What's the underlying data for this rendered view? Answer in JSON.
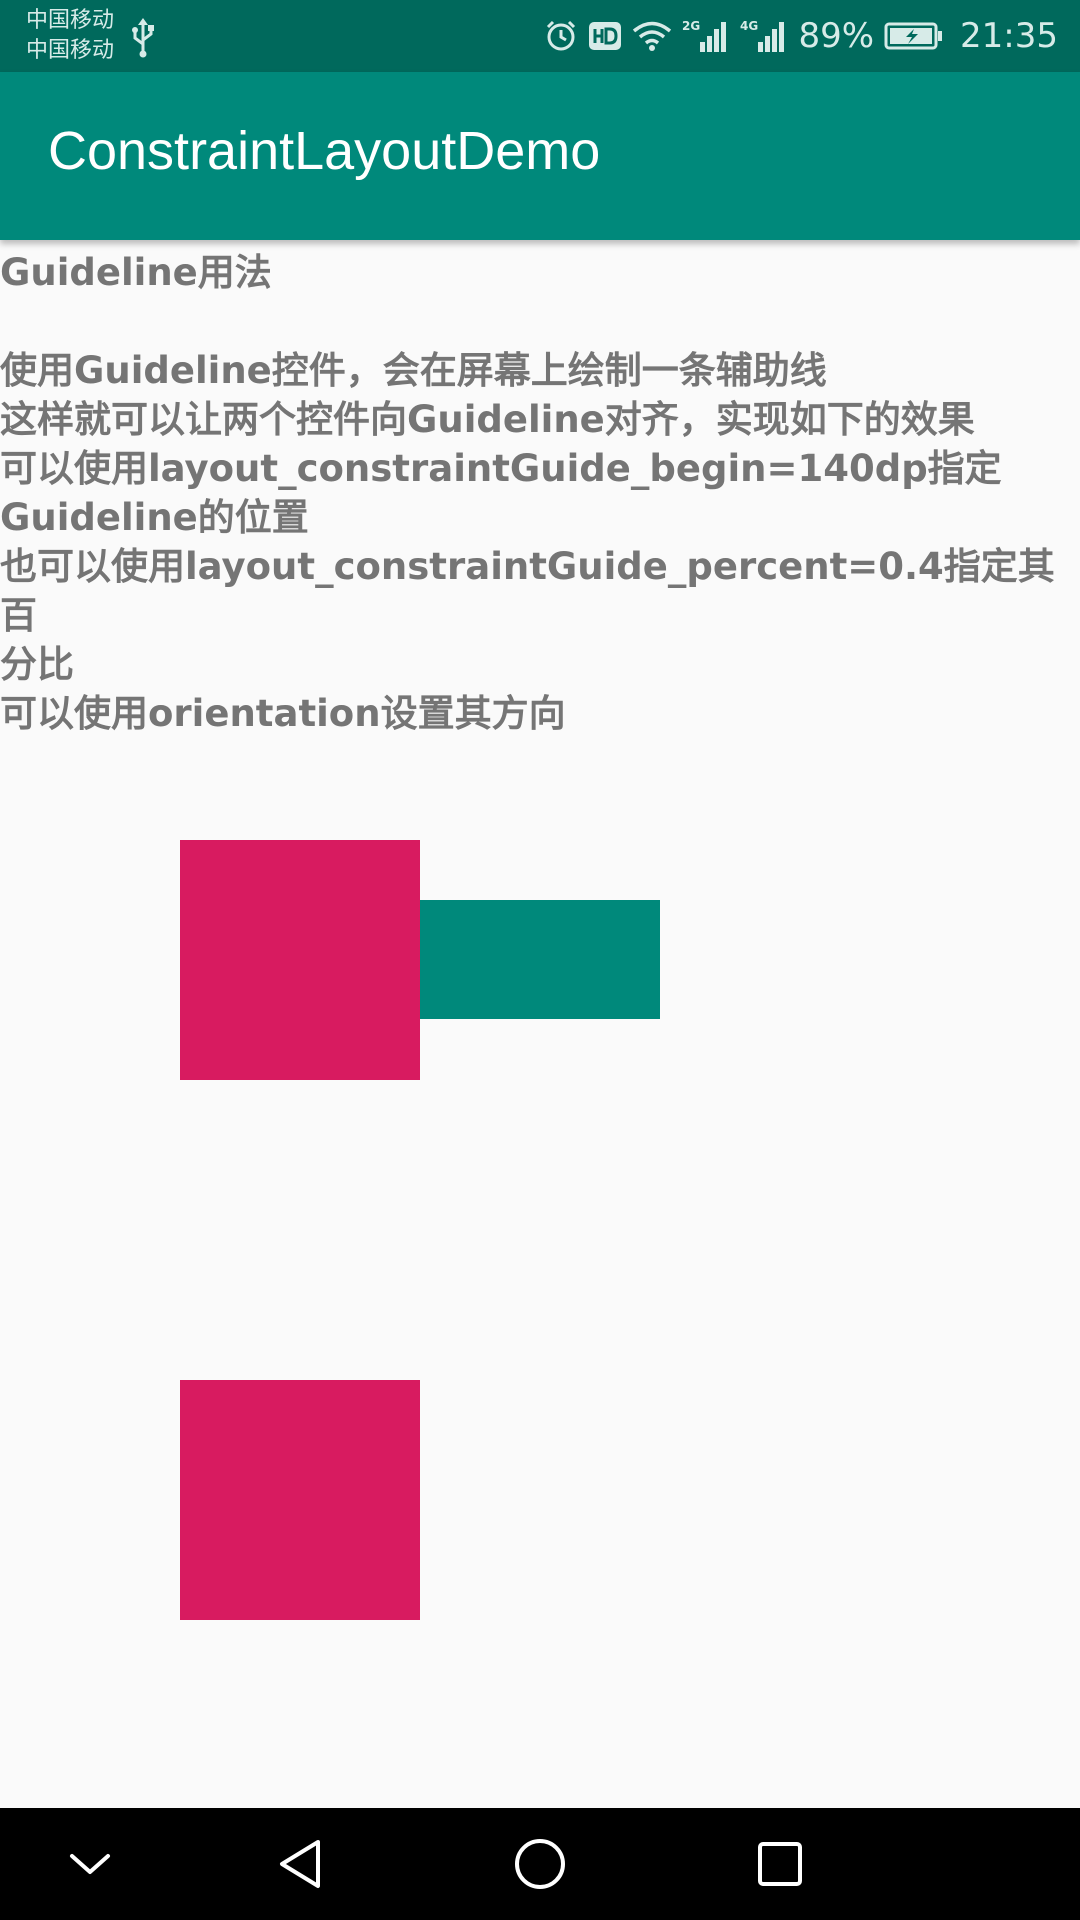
{
  "status_bar": {
    "carrier_1": "中国移动",
    "carrier_2": "中国移动",
    "signal_1_label": "2G",
    "signal_2_label": "4G",
    "battery_percent": "89%",
    "time": "21:35",
    "icons": [
      "usb-icon",
      "alarm-icon",
      "hd-icon",
      "wifi-icon",
      "signal-2g-icon",
      "signal-4g-icon",
      "battery-charging-icon"
    ]
  },
  "app_bar": {
    "title": "ConstraintLayoutDemo",
    "color": "#00897b"
  },
  "content": {
    "description": "Guideline用法\n\n使用Guideline控件，会在屏幕上绘制一条辅助线\n这样就可以让两个控件向Guideline对齐，实现如下的效果\n可以使用layout_constraintGuide_begin=140dp指定\nGuideline的位置\n也可以使用layout_constraintGuide_percent=0.4指定其百\n分比\n可以使用orientation设置其方向",
    "box_colors": {
      "pink": "#d81b60",
      "teal": "#00897b"
    }
  },
  "nav_bar": {
    "icons": [
      "hide-keyboard-icon",
      "back-icon",
      "home-icon",
      "recent-apps-icon"
    ]
  }
}
